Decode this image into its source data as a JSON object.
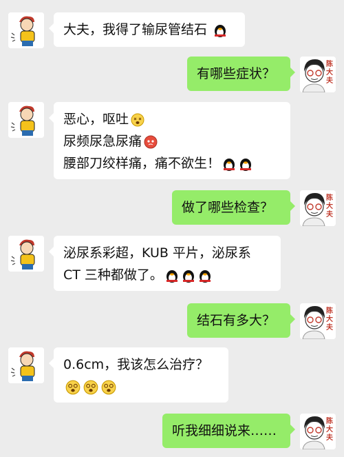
{
  "patient": {
    "icon": "cartoon-sick-boy"
  },
  "doctor": {
    "name_chars": [
      "陈",
      "大",
      "夫"
    ]
  },
  "messages": [
    {
      "side": "in",
      "lines": [
        "大夫，我得了输尿管结石"
      ]
    },
    {
      "side": "out",
      "lines": [
        "有哪些症状？"
      ]
    },
    {
      "side": "in",
      "lines": [
        "恶心，呕吐",
        "尿频尿急尿痛",
        "腰部刀绞样痛，痛不欲生！"
      ]
    },
    {
      "side": "out",
      "lines": [
        "做了哪些检查？"
      ]
    },
    {
      "side": "in",
      "lines": [
        "泌尿系彩超，KUB 平片，泌尿系",
        "CT 三种都做了。"
      ]
    },
    {
      "side": "out",
      "lines": [
        "结石有多大？"
      ]
    },
    {
      "side": "in",
      "lines": [
        "0.6cm，我该怎么治疗？"
      ]
    },
    {
      "side": "out",
      "lines": [
        "听我细细说来……"
      ]
    }
  ],
  "emoji": {
    "penguin": "qq-penguin",
    "dizzy": "dizzy-face",
    "flushed": "red-flushed-face",
    "smile": "smiling-face"
  }
}
